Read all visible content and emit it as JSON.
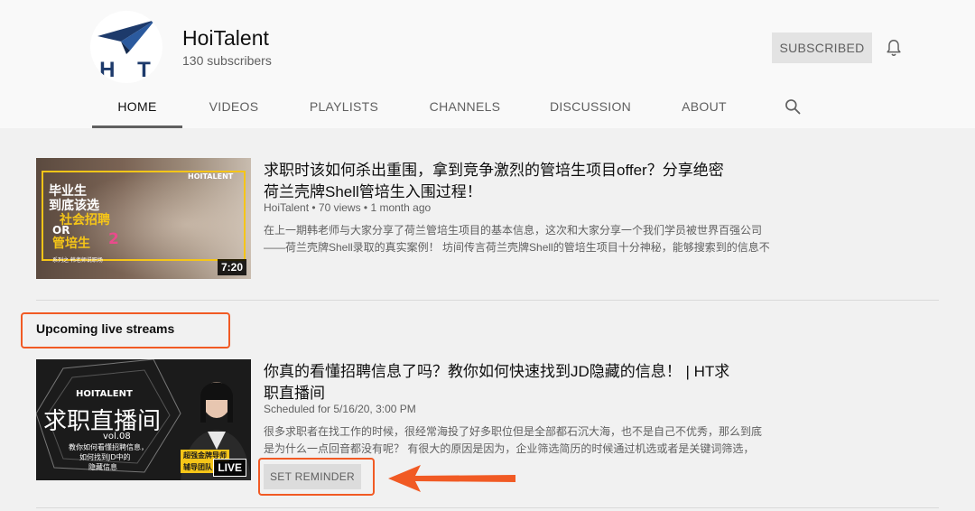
{
  "header": {
    "channel_name": "HoiTalent",
    "subscribers": "130 subscribers",
    "logo_text": "H T",
    "subscribed_label": "SUBSCRIBED"
  },
  "tabs": [
    {
      "label": "HOME",
      "active": true
    },
    {
      "label": "VIDEOS"
    },
    {
      "label": "PLAYLISTS"
    },
    {
      "label": "CHANNELS"
    },
    {
      "label": "DISCUSSION"
    },
    {
      "label": "ABOUT"
    }
  ],
  "video1": {
    "title_line1": "求职时该如何杀出重围，拿到竞争激烈的管培生项目offer？分享绝密",
    "title_line2": "荷兰壳牌Shell管培生入围过程！",
    "meta": "HoiTalent • 70 views • 1 month ago",
    "desc_line1": "在上一期韩老师与大家分享了荷兰管培生项目的基本信息，这次和大家分享一个我们学员被世界百强公司",
    "desc_line2": "——荷兰壳牌Shell录取的真实案例！ 坊间传言荷兰壳牌Shell的管培生项目十分神秘，能够搜索到的信息不",
    "duration": "7:20",
    "thumb": {
      "line1": "毕业生",
      "line2": "到底该选",
      "line3": "社会招聘",
      "line4": "OR",
      "line5": "管培生",
      "number": "2",
      "brand": "HOITALENT",
      "footer": "系列之 韩老师说职场"
    }
  },
  "upcoming": {
    "section_title": "Upcoming live streams"
  },
  "video2": {
    "title_line1": "你真的看懂招聘信息了吗？教你如何快速找到JD隐藏的信息！ | HT求",
    "title_line2": "职直播间",
    "meta": "Scheduled for 5/16/20, 3:00 PM",
    "desc_line1": "很多求职者在找工作的时候，很经常海投了好多职位但是全部都石沉大海，也不是自己不优秀，那么到底",
    "desc_line2": "是为什么一点回音都没有呢？ 有很大的原因是因为，企业筛选简历的时候通过机选或者是关键词筛选，",
    "live_badge": "LIVE",
    "reminder_label": "SET REMINDER",
    "thumb": {
      "brand": "HOITALENT",
      "big": "求职直播间",
      "vol": "vol.08",
      "sub1": "教你如何看懂招聘信息，",
      "sub2": "如何找到JD中的",
      "sub3": "隐藏信息",
      "mentor1": "超强金牌导师",
      "mentor2": "辅导团队"
    }
  },
  "colors": {
    "annotation": "#f15a24",
    "page_bg": "#f1f1f1",
    "header_bg": "#f9f9f9",
    "logo_blue": "#1d3a6b"
  },
  "icons": {
    "bell": "bell-icon",
    "search": "search-icon",
    "logo": "paper-plane-logo-icon"
  }
}
